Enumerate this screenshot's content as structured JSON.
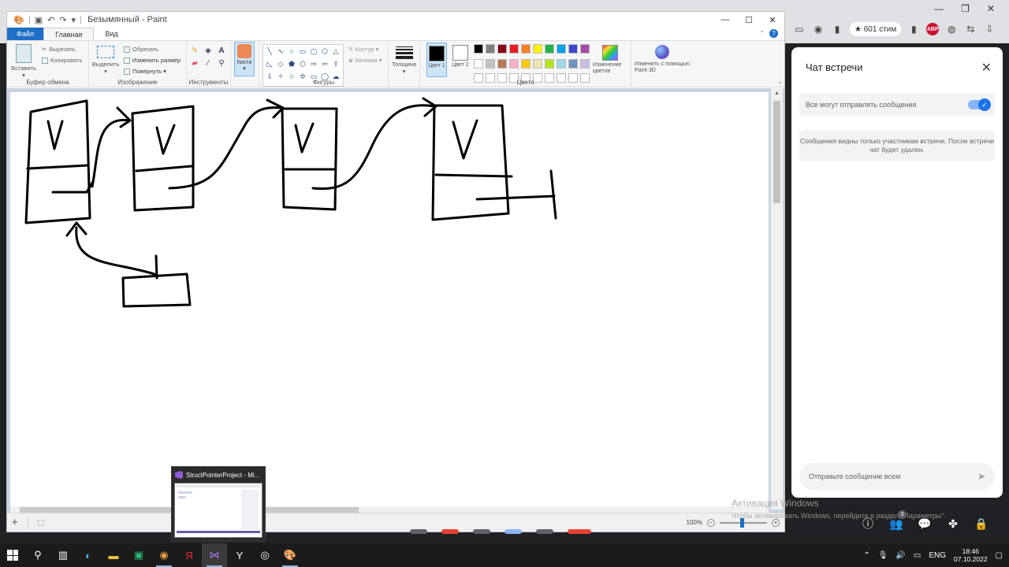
{
  "paint": {
    "title": "Безымянный - Paint",
    "tabs": {
      "file": "Файл",
      "home": "Главная",
      "view": "Вид"
    },
    "clipboard": {
      "paste": "Вставить",
      "cut": "Вырезать",
      "copy": "Копировать",
      "label": "Буфер обмена"
    },
    "image": {
      "select": "Выделить",
      "crop": "Обрезать",
      "resize": "Изменить размер",
      "rotate": "Повернуть ▾",
      "label": "Изображение"
    },
    "tools": {
      "label": "Инструменты"
    },
    "brushes": {
      "label": "Кисти"
    },
    "shapes": {
      "outline": "Контур ▾",
      "fill": "Заливка ▾",
      "label": "Фигуры"
    },
    "thickness": "Толщина",
    "colors": {
      "color1": "Цвет 1",
      "color2": "Цвет 2",
      "edit": "Изменение цветов",
      "label": "Цвета",
      "color1_value": "#000000",
      "color2_value": "#ffffff"
    },
    "paint3d": "Изменить с помощью Paint 3D",
    "palette": [
      "#000000",
      "#7f7f7f",
      "#880015",
      "#ed1c24",
      "#ff7f27",
      "#fff200",
      "#22b14c",
      "#00a2e8",
      "#3f48cc",
      "#a349a4",
      "#ffffff",
      "#c3c3c3",
      "#b97a57",
      "#ffaec9",
      "#ffc90e",
      "#efe4b0",
      "#b5e61d",
      "#99d9ea",
      "#7092be",
      "#c8bfe7",
      "#ffffff",
      "#ffffff",
      "#ffffff",
      "#ffffff",
      "#ffffff",
      "#ffffff",
      "#ffffff",
      "#ffffff",
      "#ffffff",
      "#ffffff"
    ],
    "zoom": "100%"
  },
  "browser": {
    "tab_label": "★ 601 стим"
  },
  "chat": {
    "title": "Чат встречи",
    "toggle_label": "Все могут отправлять сообщения",
    "toggle_on": true,
    "note": "Сообщения видны только участникам встречи. После встречи чат будет удален.",
    "input_placeholder": "Отправьте сообщение всем",
    "participants_badge": "3"
  },
  "watermark": {
    "line1": "Активация Windows",
    "line2": "Чтобы активировать Windows, перейдите в раздел \"Параметры\"."
  },
  "taskbar_thumb": {
    "title": "StructPointerProject - Mi..."
  },
  "tray": {
    "lang": "ENG",
    "time": "18:46",
    "date": "07.10.2022"
  }
}
